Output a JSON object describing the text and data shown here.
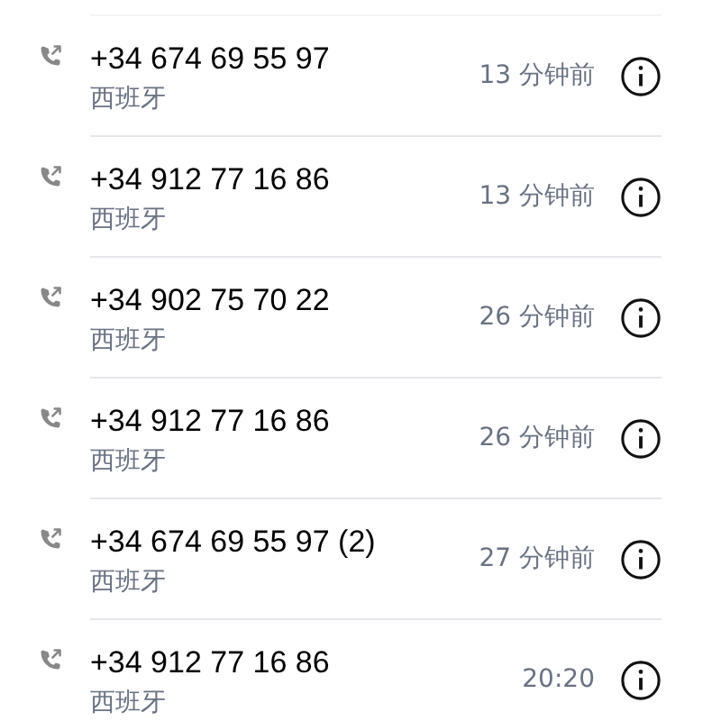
{
  "calls": [
    {
      "number": "+34 674 69 55 97",
      "region": "西班牙",
      "time": "13 分钟前"
    },
    {
      "number": "+34 912 77 16 86",
      "region": "西班牙",
      "time": "13 分钟前"
    },
    {
      "number": "+34 902 75 70 22",
      "region": "西班牙",
      "time": "26 分钟前"
    },
    {
      "number": "+34 912 77 16 86",
      "region": "西班牙",
      "time": "26 分钟前"
    },
    {
      "number": "+34 674 69 55 97 (2)",
      "region": "西班牙",
      "time": "27 分钟前"
    },
    {
      "number": "+34 912 77 16 86",
      "region": "西班牙",
      "time": "20:20"
    }
  ]
}
